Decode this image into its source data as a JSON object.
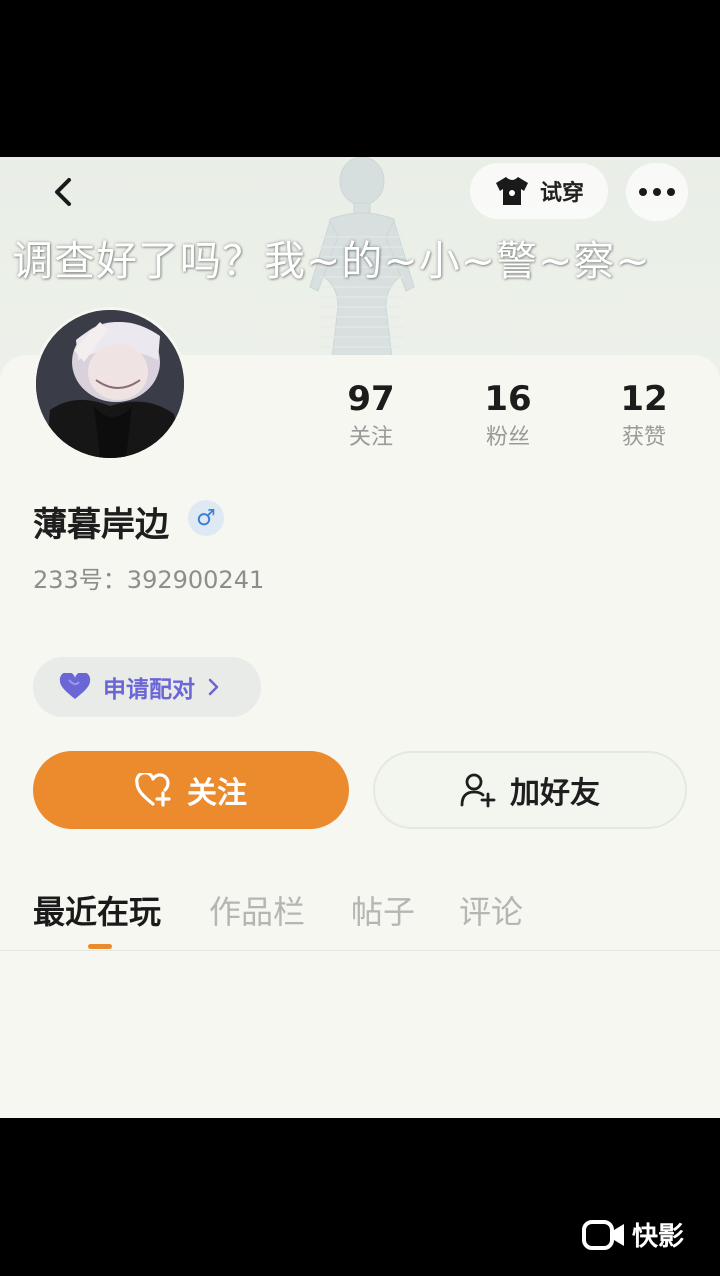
{
  "overlay_caption": "调查好了吗？我~的~小~警~察~",
  "header": {
    "tryon_label": "试穿"
  },
  "profile": {
    "username": "薄暮岸边",
    "gender_symbol": "♂",
    "user_id": "233号：392900241",
    "pair_label": "申请配对"
  },
  "stats": [
    {
      "value": "97",
      "label": "关注"
    },
    {
      "value": "16",
      "label": "粉丝"
    },
    {
      "value": "12",
      "label": "获赞"
    }
  ],
  "actions": {
    "follow_label": "关注",
    "add_friend_label": "加好友"
  },
  "tabs": [
    {
      "label": "最近在玩",
      "active": true
    },
    {
      "label": "作品栏",
      "active": false
    },
    {
      "label": "帖子",
      "active": false
    },
    {
      "label": "评论",
      "active": false
    }
  ],
  "watermark": {
    "text": "快影"
  },
  "colors": {
    "accent": "#ec8a2e",
    "pair_purple": "#6b66d6",
    "gender_blue": "#3d7fd6"
  }
}
